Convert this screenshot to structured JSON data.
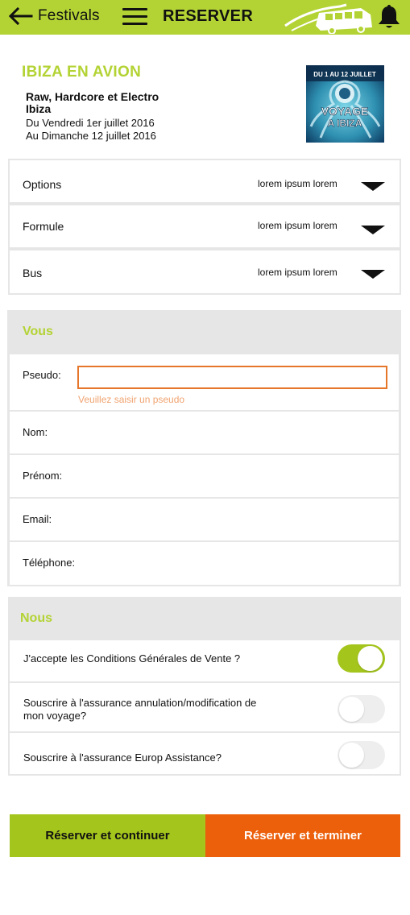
{
  "header": {
    "back_label": "Festivals",
    "title": "RESERVER",
    "back_icon": "arrow-left-icon",
    "menu_icon": "hamburger-menu-icon",
    "bell_icon": "bell-icon",
    "brand_color": "#b3d334"
  },
  "event": {
    "title": "IBIZA EN AVION",
    "name": "Raw, Hardcore et Electro Ibiza",
    "date_start": "Du Vendredi 1er juillet 2016",
    "date_end": "Au Dimanche 12 juillet 2016",
    "poster": {
      "top_text": "DU 1 AU 12 JUILLET",
      "line1": "VOYAGE",
      "line2": "A IBIZA"
    }
  },
  "options": [
    {
      "label": "Options",
      "value": "lorem ipsum lorem"
    },
    {
      "label": "Formule",
      "value": "lorem ipsum lorem"
    },
    {
      "label": "Bus",
      "value": "lorem ipsum lorem"
    }
  ],
  "vous": {
    "title": "Vous",
    "pseudo_label": "Pseudo:",
    "pseudo_value": "",
    "pseudo_error": "Veuillez saisir un pseudo",
    "fields": [
      {
        "label": "Nom:"
      },
      {
        "label": "Prénom:"
      },
      {
        "label": "Email:"
      },
      {
        "label": "Téléphone:"
      }
    ]
  },
  "nous": {
    "title": "Nous",
    "toggles": [
      {
        "label": "J'accepte les Conditions Générales de Vente ?",
        "on": true
      },
      {
        "label": "Souscrire à l'assurance annulation/modification de mon voyage?",
        "on": false
      },
      {
        "label": "Souscrire à l'assurance Europ Assistance?",
        "on": false
      }
    ]
  },
  "buttons": {
    "continue": "Réserver et continuer",
    "finish": "Réserver et terminer"
  },
  "colors": {
    "accent_green": "#b3d334",
    "button_green": "#a4c51c",
    "button_orange": "#ec5f0b",
    "error": "#e5762a"
  }
}
